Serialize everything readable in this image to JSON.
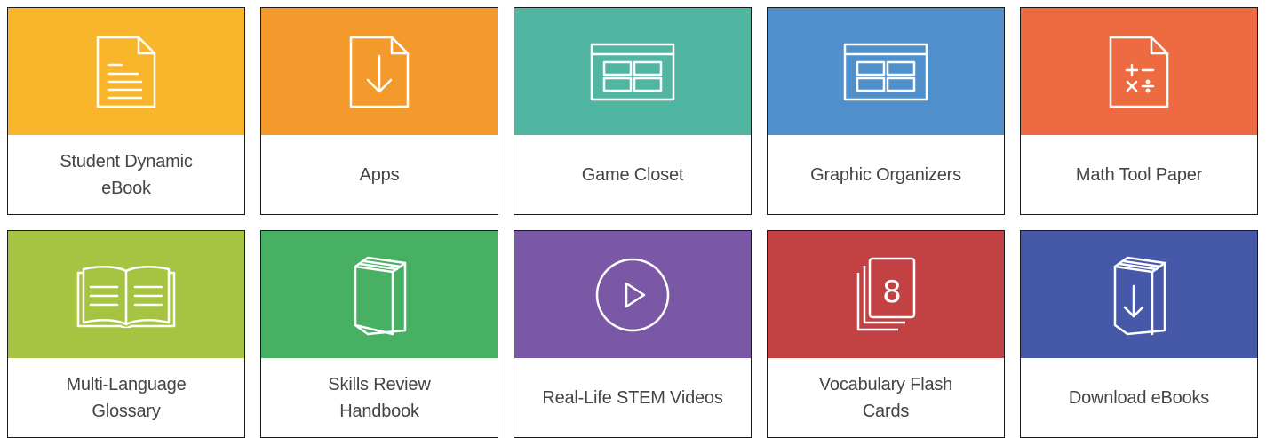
{
  "tiles": [
    {
      "label": "Student Dynamic eBook",
      "color": "#F9B52C",
      "icon": "document-icon"
    },
    {
      "label": "Apps",
      "color": "#F49A2C",
      "icon": "download-document-icon"
    },
    {
      "label": "Game Closet",
      "color": "#50B6A2",
      "icon": "game-board-icon"
    },
    {
      "label": "Graphic Organizers",
      "color": "#4E8FCC",
      "icon": "organizer-grid-icon"
    },
    {
      "label": "Math Tool Paper",
      "color": "#EE6A41",
      "icon": "math-paper-icon"
    },
    {
      "label": "Multi-Language Glossary",
      "color": "#A6C441",
      "icon": "open-book-icon"
    },
    {
      "label": "Skills Review Handbook",
      "color": "#47B063",
      "icon": "handbook-icon"
    },
    {
      "label": "Real-Life STEM Videos",
      "color": "#7B58A6",
      "icon": "play-icon"
    },
    {
      "label": "Vocabulary Flash Cards",
      "color": "#C24142",
      "icon": "flash-cards-icon",
      "card_number": "8"
    },
    {
      "label": "Download eBooks",
      "color": "#4659A8",
      "icon": "download-book-icon"
    }
  ]
}
